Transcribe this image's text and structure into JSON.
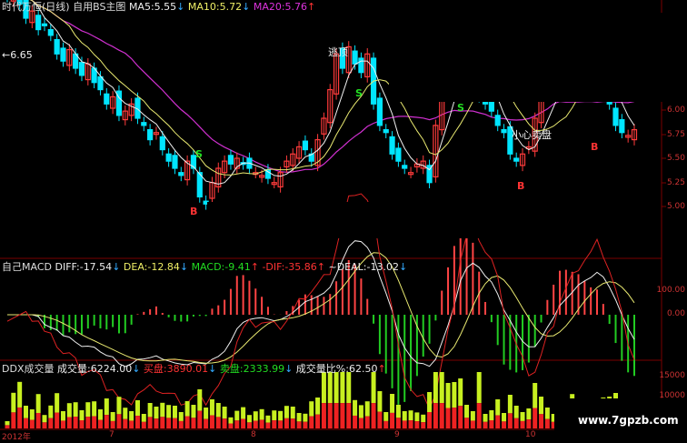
{
  "kline_header": {
    "name": "时代万恒(日线)",
    "indicator": "自用BS主图",
    "ma5_label": "MA5:",
    "ma5_value": "5.55",
    "ma5_arrow": "↓",
    "ma10_label": "MA10:",
    "ma10_value": "5.72",
    "ma10_arrow": "↓",
    "ma20_label": "MA20:",
    "ma20_value": "5.76",
    "ma20_arrow": "↑"
  },
  "macd_header": {
    "name": "自己MACD",
    "diff_label": "DIFF:",
    "diff_value": "-17.54",
    "diff_arrow": "↓",
    "dea_label": "DEA:",
    "dea_value": "-12.84",
    "dea_arrow": "↓",
    "macd_label": "MACD:",
    "macd_value": "-9.41",
    "macd_arrow": "↑",
    "dif_label": "-DIF:",
    "dif_value": "-35.86",
    "dif_arrow": "↑",
    "deal_label": "~DEAL:",
    "deal_value": "-13.02",
    "deal_arrow": "↓"
  },
  "ddx_header": {
    "name": "DDX成交量",
    "vol_label": "成交量:",
    "vol_value": "6224.00",
    "vol_arrow": "↓",
    "buy_label": "买盘:",
    "buy_value": "3890.01",
    "buy_arrow": "↓",
    "sell_label": "卖盘:",
    "sell_value": "2333.99",
    "sell_arrow": "↓",
    "ratio_label": "成交量比%:",
    "ratio_value": "62.50",
    "ratio_arrow": "↑"
  },
  "annotations": {
    "start_price": "6.65",
    "escape": "逃顶",
    "caution": "小心卖盘",
    "sell_mark": "S",
    "buy_mark": "B"
  },
  "price_axis": [
    "6.00",
    "5.75",
    "5.50",
    "5.25",
    "5.00"
  ],
  "macd_axis": [
    "100.00",
    "0.00"
  ],
  "vol_axis": [
    "15000",
    "10000"
  ],
  "x_dates": [
    "2012年",
    "7",
    "8",
    "9",
    "10"
  ],
  "watermark": "www.7gpzb.com",
  "colors": {
    "up": "#ff3b3b",
    "down": "#00e5ff",
    "ma5": "#f0f0f0",
    "ma10": "#e8e870",
    "ma20": "#d030d0",
    "signal_s": "#22dd22",
    "signal_b": "#ff3030",
    "grid": "#7a0000"
  },
  "chart_data": {
    "type": "candlestick",
    "ylim": [
      4.9,
      6.3
    ],
    "closes": [
      6.45,
      6.62,
      6.4,
      6.3,
      6.35,
      6.22,
      6.25,
      6.18,
      6.05,
      6.0,
      6.08,
      5.95,
      5.9,
      5.98,
      5.85,
      5.8,
      5.7,
      5.75,
      5.62,
      5.65,
      5.7,
      5.6,
      5.55,
      5.45,
      5.5,
      5.38,
      5.3,
      5.25,
      5.2,
      5.3,
      5.25,
      5.05,
      5.0,
      5.15,
      5.25,
      5.3,
      5.28,
      5.32,
      5.28,
      5.25,
      5.22,
      5.2,
      5.18,
      5.15,
      5.22,
      5.3,
      5.35,
      5.4,
      5.38,
      5.3,
      5.45,
      5.6,
      5.8,
      6.05,
      5.95,
      6.1,
      5.98,
      5.92,
      6.05,
      5.7,
      5.55,
      5.5,
      5.35,
      5.3,
      5.25,
      5.22,
      5.28,
      5.3,
      5.15,
      5.55,
      5.9,
      5.95,
      6.05,
      5.95,
      6.0,
      6.05,
      5.75,
      5.7,
      5.65,
      5.55,
      5.5,
      5.35,
      5.3,
      5.35,
      5.4,
      5.6,
      5.75,
      5.8,
      5.85,
      5.9,
      5.8,
      5.98,
      6.05,
      6.0,
      6.02,
      5.95,
      5.85,
      5.7,
      5.55,
      5.5,
      5.48,
      5.52
    ],
    "ma5_last": 5.55,
    "ma10_last": 5.72,
    "ma20_last": 5.76
  }
}
